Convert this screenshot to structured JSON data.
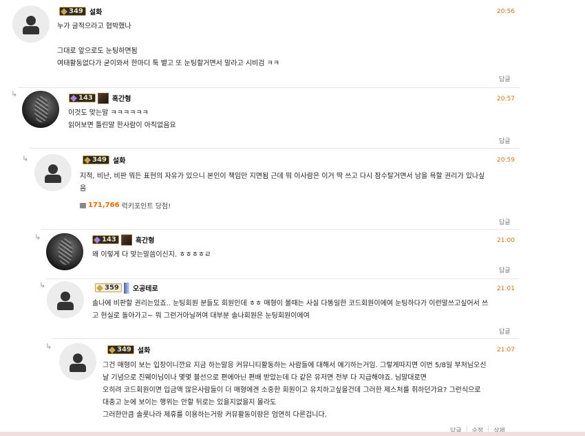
{
  "comments": [
    {
      "level": "349",
      "nick": "설화",
      "time": "20:56",
      "lines": [
        "누가 글적으라고 협박했나",
        "",
        "그대로 앞으로도 눈팅하면됨",
        "여태활동없다가 굳이와서 한마디 툭 뱉고 또 눈팅할거면서 말라고 시비검 ㅋㅋ"
      ],
      "reply": "답글"
    },
    {
      "level": "143",
      "nick": "흑간형",
      "time": "20:57",
      "lines": [
        "이것도 맞는말 ㅋㅋㅋㅋㅋㅋ",
        "읽어보면 틀린말 한사람이 아직없음요"
      ],
      "reply": "답글"
    },
    {
      "level": "349",
      "nick": "설화",
      "time": "20:59",
      "lines": [
        "지적, 비난, 비판 뭐든 표현의 자유가 있으니 본인이 책임만 지면됨 근데 뭐 이사람은 이거 딱 쓰고 다시 잠수탈거면서 남을 욕할 권리가 있나싶",
        "음"
      ],
      "point_amount": "171,766",
      "point_text": "럭키포인트 당첨!",
      "reply": "답글"
    },
    {
      "level": "143",
      "nick": "흑간형",
      "time": "21:00",
      "lines": [
        "왜 이렇게 다 맞는말씀이신지. ㅎㅎㅎㅎㄹ"
      ],
      "reply": "답글"
    },
    {
      "level": "359",
      "nick": "오공테로",
      "time": "21:01",
      "lines": [
        "솔나에 비판할 권리는있죠.. 눈팅회원 분들도 회원인데 ㅎㅎ 매형이 볼때는 사실 다똥일한 코드회원이에여 눈팅하다가 이런말쓰고싶어서 쓰",
        "고 현실로 돌아가고~ 뭐 그런거아닐꺼여 대부분 솔나회원은 눈팅회원이에여"
      ],
      "reply": "답글"
    },
    {
      "level": "349",
      "nick": "설화",
      "time": "21:07",
      "lines": [
        "그건 매형이 보는 입장이니깐요 지금 하는말응 커뮤니티활동하는 사람들에 대해서 얘기하는거임. 그렇게따지면 이번 5/8일 부처님오신",
        "날 기념으로 진웨이님이나 몇몇 블선으로 편에아닌 편배 받았는데 다 같은 유저면 전부 다 지급해야죠. 님말대로면",
        "오히려 코드회원이면 입금액 많은사람들이 더 매형에겐 소중한 회원이고 유치하고싶을건데 그러한 제스처를 취하던가요? 그런식으로",
        "대충고 눈에 보이는 행위는 안할 뒤로는 있을지없을지 몰라도",
        "그러한만큼 솔룻나라 제휴를 이용하는거랑 커뮤활동이랑은 엄연히 다른겁니다."
      ],
      "actions": [
        "답글",
        "수정",
        "삭제"
      ]
    }
  ]
}
